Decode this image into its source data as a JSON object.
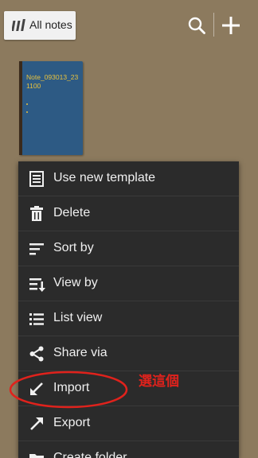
{
  "header": {
    "folder_button_label": "All notes",
    "folder_icon": "notebooks-icon",
    "search_icon": "search-icon",
    "add_icon": "plus-icon"
  },
  "notebook": {
    "title": "Note_093013_231100",
    "cover_color": "#2d5a84",
    "title_color": "#e9c23e"
  },
  "menu": {
    "items": [
      {
        "label": "Use new template",
        "icon": "template-icon"
      },
      {
        "label": "Delete",
        "icon": "trash-icon"
      },
      {
        "label": "Sort by",
        "icon": "sort-icon"
      },
      {
        "label": "View by",
        "icon": "view-by-icon"
      },
      {
        "label": "List view",
        "icon": "list-icon"
      },
      {
        "label": "Share via",
        "icon": "share-icon"
      },
      {
        "label": "Import",
        "icon": "import-arrow-icon"
      },
      {
        "label": "Export",
        "icon": "export-arrow-icon"
      },
      {
        "label": "Create folder",
        "icon": "folder-icon"
      }
    ]
  },
  "annotation": {
    "text": "選這個",
    "color": "#e0221c"
  }
}
